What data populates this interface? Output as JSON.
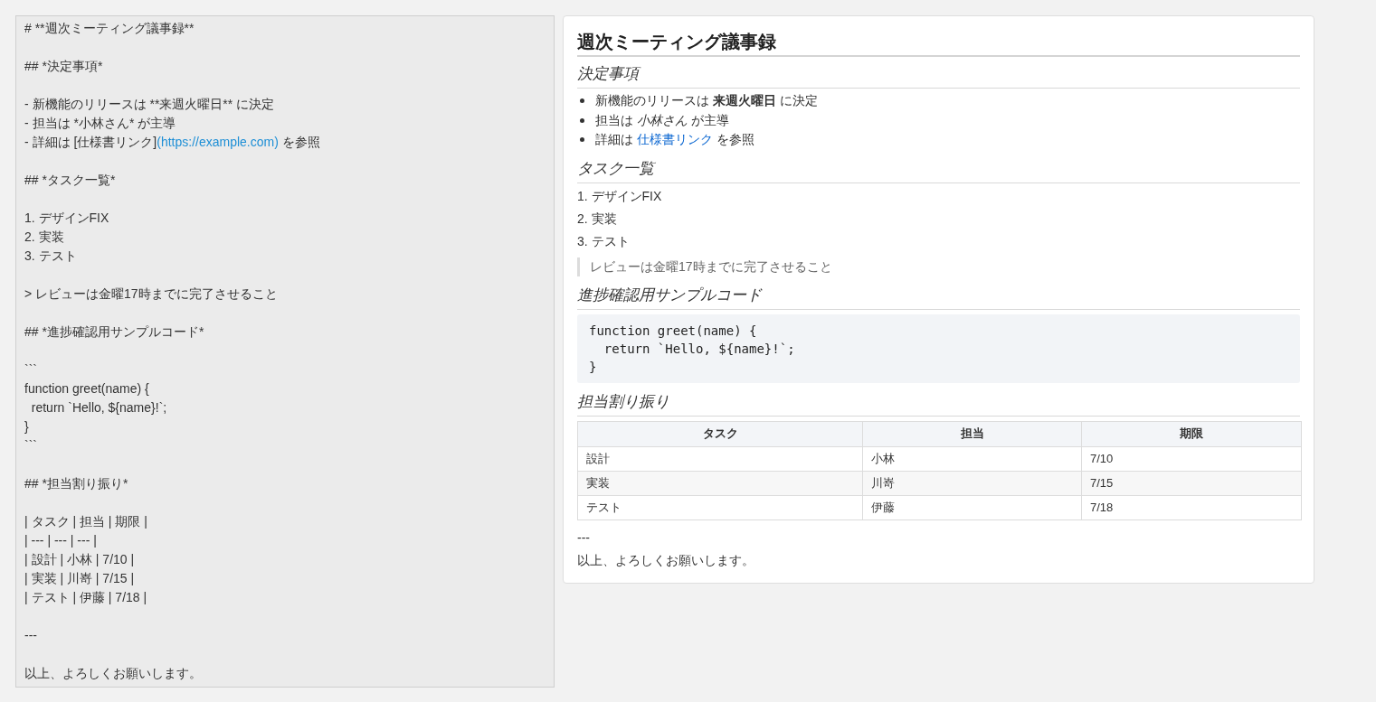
{
  "editor": {
    "lines": [
      {
        "kind": "text",
        "text": "# **週次ミーティング議事録**"
      },
      {
        "kind": "blank"
      },
      {
        "kind": "text",
        "text": "## *決定事項*"
      },
      {
        "kind": "blank"
      },
      {
        "kind": "text",
        "text": "- 新機能のリリースは **来週火曜日** に決定"
      },
      {
        "kind": "text",
        "text": "- 担当は *小林さん* が主導"
      },
      {
        "kind": "link",
        "before": "- 詳細は [仕様書リンク]",
        "url": "(https://example.com)",
        "after": " を参照"
      },
      {
        "kind": "blank"
      },
      {
        "kind": "text",
        "text": "## *タスク一覧*"
      },
      {
        "kind": "blank"
      },
      {
        "kind": "text",
        "text": "1. デザインFIX"
      },
      {
        "kind": "text",
        "text": "2. 実装"
      },
      {
        "kind": "text",
        "text": "3. テスト"
      },
      {
        "kind": "blank"
      },
      {
        "kind": "text",
        "text": "> レビューは金曜17時までに完了させること"
      },
      {
        "kind": "blank"
      },
      {
        "kind": "text",
        "text": "## *進捗確認用サンプルコード*"
      },
      {
        "kind": "blank"
      },
      {
        "kind": "text",
        "text": "```"
      },
      {
        "kind": "text",
        "text": "function greet(name) {"
      },
      {
        "kind": "text",
        "text": "  return `Hello, ${name}!`;"
      },
      {
        "kind": "text",
        "text": "}"
      },
      {
        "kind": "text",
        "text": "```"
      },
      {
        "kind": "blank"
      },
      {
        "kind": "text",
        "text": "## *担当割り振り*"
      },
      {
        "kind": "blank"
      },
      {
        "kind": "text",
        "text": "| タスク | 担当 | 期限 |"
      },
      {
        "kind": "text",
        "text": "| --- | --- | --- |"
      },
      {
        "kind": "text",
        "text": "| 設計 | 小林 | 7/10 |"
      },
      {
        "kind": "text",
        "text": "| 実装 | 川嵜 | 7/15 |"
      },
      {
        "kind": "text",
        "text": "| テスト | 伊藤 | 7/18 |"
      },
      {
        "kind": "blank"
      },
      {
        "kind": "text",
        "text": "---"
      },
      {
        "kind": "blank"
      },
      {
        "kind": "text",
        "text": "以上、よろしくお願いします。"
      }
    ]
  },
  "preview": {
    "title": "週次ミーティング議事録",
    "sections": [
      {
        "heading": "決定事項",
        "blocks": [
          {
            "kind": "bullets",
            "items": [
              {
                "parts": [
                  {
                    "kind": "text",
                    "text": "新機能のリリースは **来週火曜日** に決定"
                  }
                ]
              },
              {
                "parts": [
                  {
                    "kind": "text",
                    "text": "担当は *小林さん* が主導"
                  }
                ]
              },
              {
                "parts": [
                  {
                    "kind": "text",
                    "text": "詳細は "
                  },
                  {
                    "kind": "link",
                    "text": "仕様書リンク"
                  },
                  {
                    "kind": "text",
                    "text": " を参照"
                  }
                ]
              }
            ]
          }
        ]
      },
      {
        "heading": "タスク一覧",
        "blocks": [
          {
            "kind": "paragraph",
            "text": "1. デザインFIX"
          },
          {
            "kind": "paragraph",
            "text": "2. 実装"
          },
          {
            "kind": "paragraph",
            "text": "3. テスト"
          },
          {
            "kind": "quote",
            "text": "レビューは金曜17時までに完了させること"
          }
        ]
      },
      {
        "heading": "進捗確認用サンプルコード",
        "blocks": [
          {
            "kind": "code",
            "lines": [
              "function greet(name) {",
              "  return `Hello, ${name}!`;",
              "}"
            ]
          }
        ]
      },
      {
        "heading": "担当割り振り",
        "blocks": [
          {
            "kind": "table",
            "columns": [
              "タスク",
              "担当",
              "期限"
            ],
            "rows": [
              [
                "設計",
                "小林",
                "7/10"
              ],
              [
                "実装",
                "川嵜",
                "7/15"
              ],
              [
                "テスト",
                "伊藤",
                "7/18"
              ]
            ]
          },
          {
            "kind": "paragraph",
            "text": "---"
          },
          {
            "kind": "paragraph",
            "text": "以上、よろしくお願いします。"
          }
        ]
      }
    ]
  }
}
